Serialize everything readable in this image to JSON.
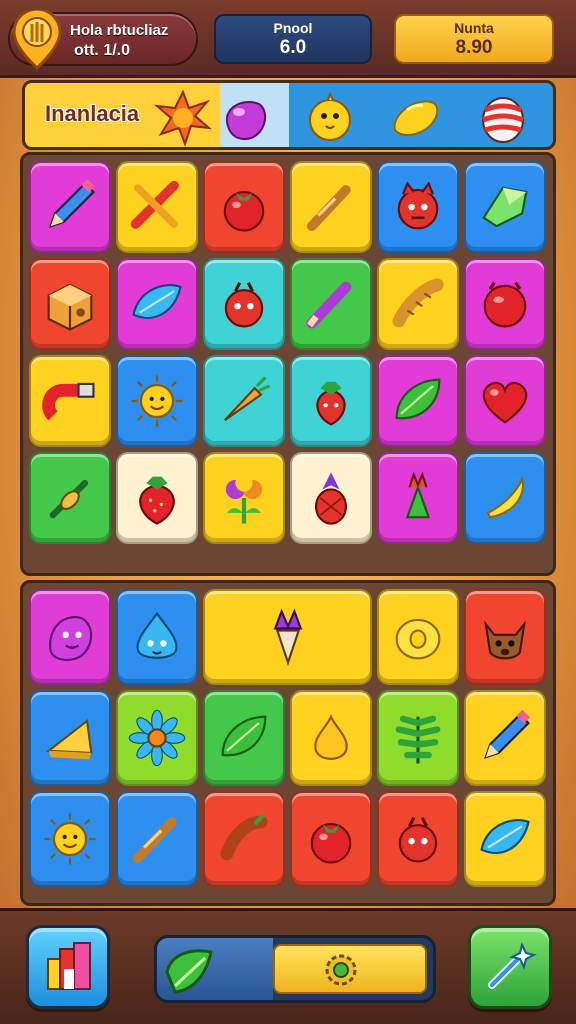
{
  "hud": {
    "player_name": "Hola rbtucliaz",
    "player_sub": "ott. 1/.0",
    "stat_blue_label": "Pnool",
    "stat_blue_value": "6.0",
    "stat_gold_label": "Nunta",
    "stat_gold_value": "8.90"
  },
  "header": {
    "title": "Inanlacia",
    "icons": [
      "sun-burst-icon",
      "purple-blob-icon",
      "yellow-chick-icon",
      "lemon-icon",
      "striped-egg-icon"
    ]
  },
  "colors": {
    "magenta": "#e23cd7",
    "yellow": "#ffd21f",
    "red": "#f04630",
    "blue": "#2d8ff0",
    "green": "#43c84a",
    "cyan": "#3fd3d6",
    "cream": "#fff2d0",
    "lime": "#8fdc2c"
  },
  "board_top": [
    [
      {
        "c": "magenta",
        "i": "pencil-icon"
      },
      {
        "c": "yellow",
        "i": "crossed-crayons-icon"
      },
      {
        "c": "red",
        "i": "tomato-icon"
      },
      {
        "c": "yellow",
        "i": "crayon-icon"
      },
      {
        "c": "blue",
        "i": "red-monster-icon"
      },
      {
        "c": "blue",
        "i": "green-gem-icon"
      }
    ],
    [
      {
        "c": "red",
        "i": "box-icon"
      },
      {
        "c": "magenta",
        "i": "blue-leaf-icon"
      },
      {
        "c": "cyan",
        "i": "red-bug-icon"
      },
      {
        "c": "green",
        "i": "purple-crayon-icon"
      },
      {
        "c": "yellow",
        "i": "baguette-icon"
      },
      {
        "c": "magenta",
        "i": "red-ball-icon"
      }
    ],
    [
      {
        "c": "yellow",
        "i": "magnet-icon"
      },
      {
        "c": "blue",
        "i": "sun-face-icon"
      },
      {
        "c": "cyan",
        "i": "carrot-icon"
      },
      {
        "c": "cyan",
        "i": "strawberry-bug-icon"
      },
      {
        "c": "magenta",
        "i": "green-leaf-icon"
      },
      {
        "c": "magenta",
        "i": "heart-icon"
      }
    ],
    [
      {
        "c": "green",
        "i": "pin-icon"
      },
      {
        "c": "cream",
        "i": "strawberry-icon"
      },
      {
        "c": "yellow",
        "i": "flower-bunch-icon"
      },
      {
        "c": "cream",
        "i": "pineapple-icon"
      },
      {
        "c": "magenta",
        "i": "veggie-bunch-icon"
      },
      {
        "c": "blue",
        "i": "banana-icon"
      }
    ]
  ],
  "board_bottom": [
    [
      {
        "c": "magenta",
        "i": "purple-monster-icon"
      },
      {
        "c": "blue",
        "i": "blue-drop-icon"
      },
      {
        "c": "yellow",
        "i": "ice-cream-icon",
        "w": 2
      },
      {
        "c": "yellow",
        "i": "donut-icon"
      },
      {
        "c": "red",
        "i": "fox-icon"
      }
    ],
    [
      {
        "c": "blue",
        "i": "cheese-icon"
      },
      {
        "c": "lime",
        "i": "daisy-icon"
      },
      {
        "c": "green",
        "i": "green-leaf-icon"
      },
      {
        "c": "yellow",
        "i": "onion-icon"
      },
      {
        "c": "lime",
        "i": "fern-icon"
      },
      {
        "c": "yellow",
        "i": "pencil-icon"
      }
    ],
    [
      {
        "c": "blue",
        "i": "sun-face-icon"
      },
      {
        "c": "blue",
        "i": "crayon-icon"
      },
      {
        "c": "red",
        "i": "sausage-icon"
      },
      {
        "c": "red",
        "i": "tomato-icon"
      },
      {
        "c": "red",
        "i": "red-bug-icon"
      },
      {
        "c": "yellow",
        "i": "blue-leaf-icon"
      }
    ]
  ],
  "footer": {
    "left_button_icon": "blocks-icon",
    "progress_icon": "leaf-icon",
    "progress_marker_icon": "gear-icon",
    "progress_fill": 0.58,
    "right_button_icon": "wand-icon"
  }
}
